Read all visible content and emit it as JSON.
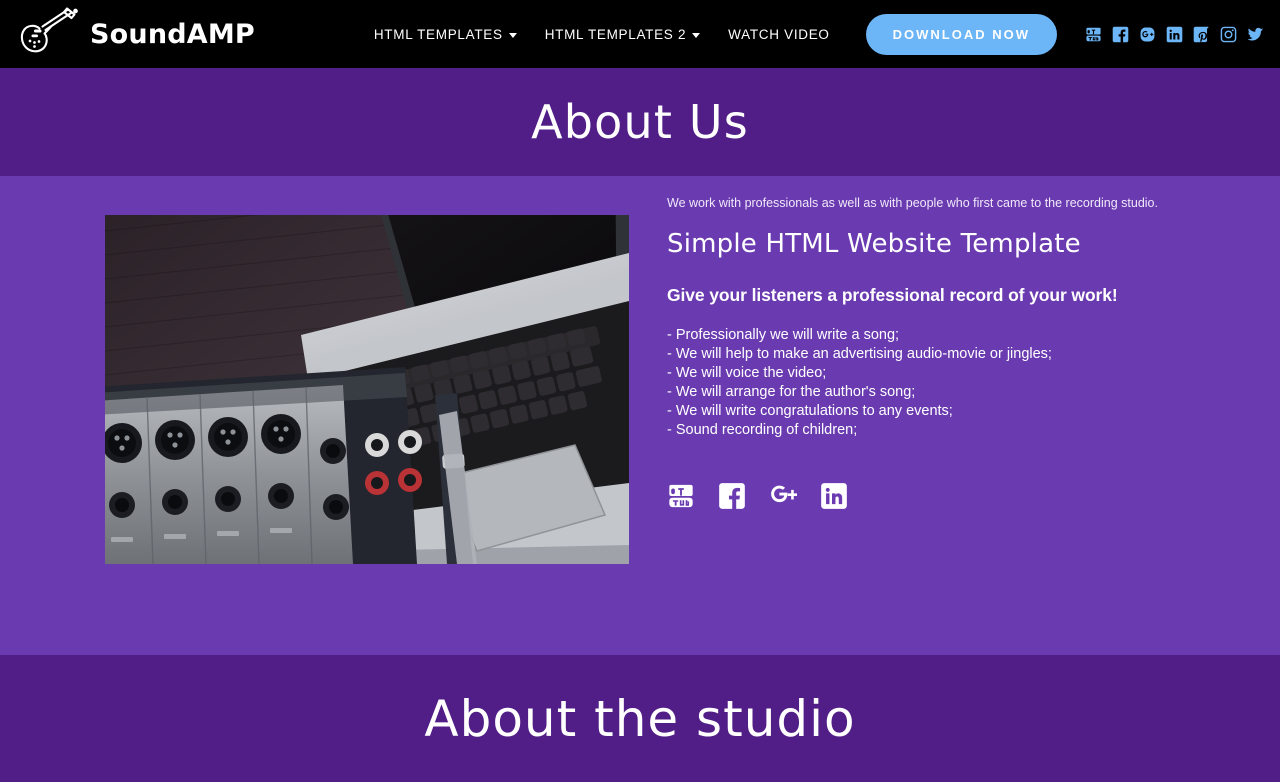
{
  "header": {
    "brand_name": "SoundAMP",
    "logo_icon": "guitar-icon",
    "nav": [
      {
        "label": "HTML TEMPLATES",
        "has_dropdown": true
      },
      {
        "label": "HTML TEMPLATES 2",
        "has_dropdown": true
      },
      {
        "label": "WATCH VIDEO",
        "has_dropdown": false
      }
    ],
    "download_label": "DOWNLOAD NOW",
    "download_color": "#6cb5f7",
    "socials": [
      {
        "name": "youtube-icon"
      },
      {
        "name": "facebook-icon"
      },
      {
        "name": "google-plus-icon"
      },
      {
        "name": "linkedin-icon"
      },
      {
        "name": "pinterest-icon"
      },
      {
        "name": "instagram-icon"
      },
      {
        "name": "twitter-icon"
      }
    ]
  },
  "title_band": {
    "title": "About Us",
    "background": "#511e87"
  },
  "about": {
    "background": "#6a3ab0",
    "image_alt": "audio mixer and laptop on dark wooden desk",
    "intro": "We work with professionals as well as with people who first came to the recording studio.",
    "heading": "Simple HTML Website Template",
    "subheading": "Give your listeners a professional record of your work!",
    "services": [
      "- Professionally we will write a song;",
      "- We will help to make an advertising audio-movie or jingles;",
      "- We will voice the video;",
      "- We will arrange for the author's song;",
      "- We will write congratulations to any events;",
      "- Sound recording of children;"
    ],
    "socials": [
      {
        "name": "youtube-icon"
      },
      {
        "name": "facebook-icon"
      },
      {
        "name": "google-plus-icon"
      },
      {
        "name": "linkedin-icon"
      }
    ]
  },
  "studio_band": {
    "title": "About the studio",
    "background": "#511e87"
  }
}
